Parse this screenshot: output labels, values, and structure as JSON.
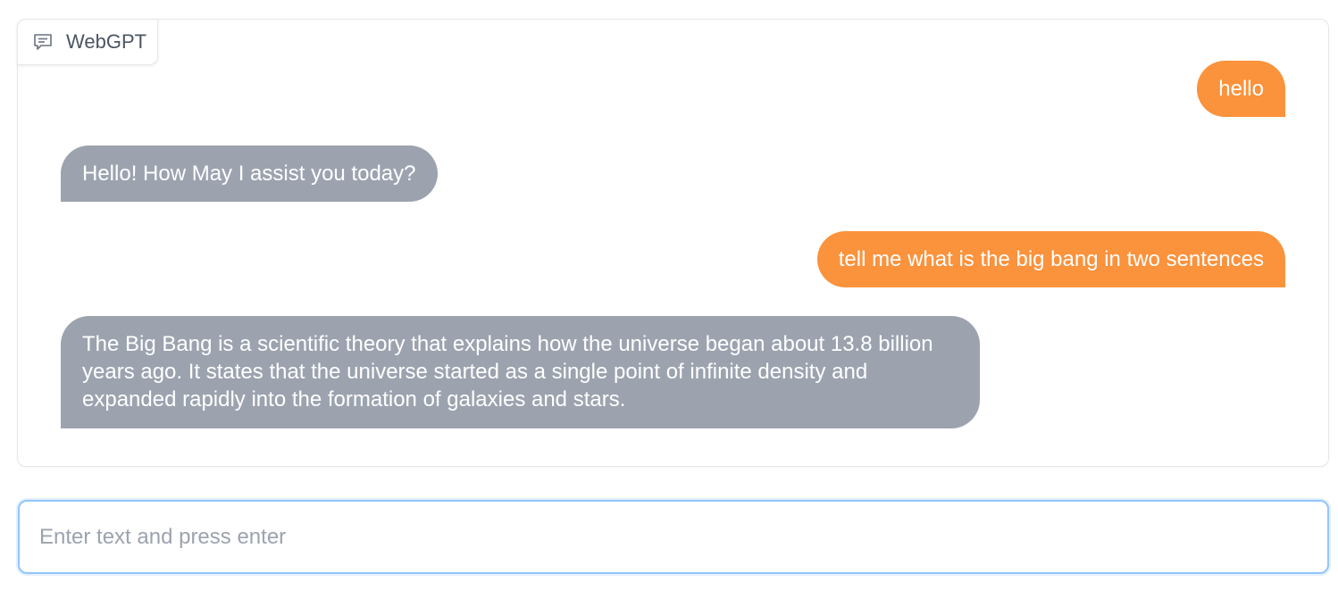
{
  "chat": {
    "label": "WebGPT",
    "label_icon": "chat-bubble-icon",
    "messages": [
      {
        "role": "user",
        "text": "hello"
      },
      {
        "role": "bot",
        "text": "Hello! How May I assist you today?"
      },
      {
        "role": "user",
        "text": "tell me what is the big bang in two sentences"
      },
      {
        "role": "bot",
        "text": "The Big Bang is a scientific theory that explains how the universe began about 13.8 billion years ago. It states that the universe started as a single point of infinite density and expanded rapidly into the formation of galaxies and stars."
      }
    ]
  },
  "input": {
    "placeholder": "Enter text and press enter",
    "value": ""
  },
  "colors": {
    "user_bubble": "#fb923c",
    "bot_bubble": "#9ca3af",
    "input_focus_border": "#93c5fd"
  }
}
